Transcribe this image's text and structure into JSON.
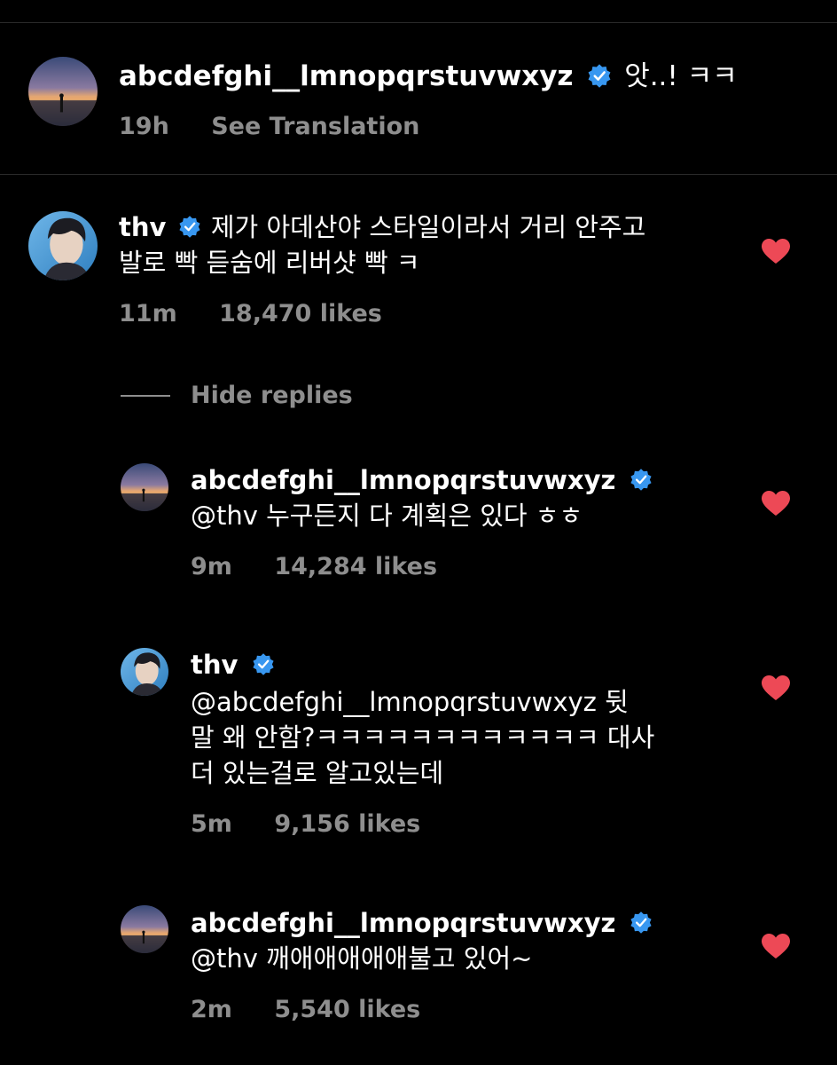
{
  "colors": {
    "background": "#000000",
    "text": "#ffffff",
    "meta": "#8e8e8e",
    "verified": "#3897f0",
    "heart": "#ed4956"
  },
  "top_comment": {
    "username": "abcdefghi__lmnopqrstuvwxyz",
    "text": "앗..! ㅋㅋ",
    "time": "19h",
    "see_translation": "See Translation"
  },
  "main_comment": {
    "username": "thv",
    "text_line1": "제가 아데산야 스타일이라서 거리 안주고",
    "text_line2": "발로 빡 듣숨에 리버샷 빡 ㅋ",
    "time": "11m",
    "likes": "18,470 likes"
  },
  "hide_replies_label": "Hide replies",
  "replies": [
    {
      "username": "abcdefghi__lmnopqrstuvwxyz",
      "lines": [
        "@thv 누구든지 다 계획은 있다 ㅎㅎ"
      ],
      "time": "9m",
      "likes": "14,284 likes"
    },
    {
      "username": "thv",
      "lines": [
        "@abcdefghi__lmnopqrstuvwxyz  뒷",
        "말 왜 안함?ㅋㅋㅋㅋㅋㅋㅋㅋㅋㅋㅋㅋ 대사",
        "더 있는걸로 알고있는데"
      ],
      "time": "5m",
      "likes": "9,156 likes"
    },
    {
      "username": "abcdefghi__lmnopqrstuvwxyz",
      "lines": [
        "@thv 깨애애애애애불고 있어~"
      ],
      "time": "2m",
      "likes": "5,540 likes"
    }
  ],
  "icons": {
    "verified": "verified-badge-icon",
    "heart": "heart-icon",
    "avatar_sunset": "sunset-silhouette-avatar",
    "avatar_person": "person-portrait-avatar"
  }
}
